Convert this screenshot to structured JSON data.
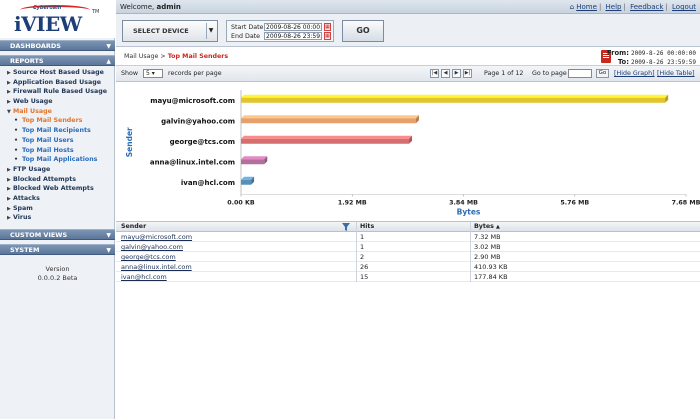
{
  "brand": {
    "company": "Cyberoam",
    "product": "iVIEW",
    "tm": "TM"
  },
  "header": {
    "welcome_prefix": "Welcome, ",
    "username": "admin",
    "links": [
      "Home",
      "Help",
      "Feedback",
      "Logout"
    ]
  },
  "sidebar": {
    "sections": {
      "dashboards": "DASHBOARDS",
      "reports": "REPORTS",
      "custom_views": "CUSTOM VIEWS",
      "system": "SYSTEM"
    },
    "report_items": [
      "Source Host Based Usage",
      "Application Based Usage",
      "Firewall Rule Based Usage",
      "Web Usage",
      "Mail Usage"
    ],
    "mail_sub_items": [
      "Top Mail Senders",
      "Top Mail Recipients",
      "Top Mail Users",
      "Top Mail Hosts",
      "Top Mail Applications"
    ],
    "report_items_after": [
      "FTP Usage",
      "Blocked Attempts",
      "Blocked Web Attempts",
      "Attacks",
      "Spam",
      "Virus"
    ],
    "version_label": "Version",
    "version_value": "0.0.0.2 Beta"
  },
  "controls": {
    "device_label": "SELECT DEVICE",
    "start_label": "Start Date",
    "start_value": "2009-08-26 00:00:",
    "end_label": "End Date",
    "end_value": "2009-08-26 23:59:",
    "go_label": "GO"
  },
  "breadcrumb": {
    "parent": "Mail Usage",
    "separator": " > ",
    "current": "Top Mail Senders"
  },
  "range": {
    "from_label": "From:",
    "from_value": "2009-8-26 00:00:00",
    "to_label": "To:",
    "to_value": "2009-8-26 23:59:59"
  },
  "toolbar": {
    "show_label": "Show",
    "rpp_value": "5",
    "rpp_suffix": "records per page",
    "page_info": "Page 1 of 12",
    "goto_label": "Go to page :",
    "go_small": "Go",
    "hide_graph": "[Hide Graph]",
    "hide_table": "[Hide Table]"
  },
  "chart_data": {
    "type": "bar",
    "orientation": "horizontal",
    "categories": [
      "mayu@microsoft.com",
      "galvin@yahoo.com",
      "george@tcs.com",
      "anna@linux.intel.com",
      "ivan@hcl.com"
    ],
    "values": [
      7.32,
      3.02,
      2.9,
      0.401,
      0.174
    ],
    "colors": [
      "#e3c42b",
      "#e8a06a",
      "#d56e6e",
      "#b4709c",
      "#5a8fb8"
    ],
    "xlim": [
      0,
      7.68
    ],
    "xticks": [
      "0.00 KB",
      "1.92 MB",
      "3.84 MB",
      "5.76 MB",
      "7.68 MB"
    ],
    "xlabel": "Bytes",
    "ylabel": "Sender"
  },
  "table": {
    "headers": {
      "sender": "Sender",
      "hits": "Hits",
      "bytes": "Bytes"
    },
    "rows": [
      {
        "sender": "mayu@microsoft.com",
        "hits": "1",
        "bytes": "7.32 MB"
      },
      {
        "sender": "galvin@yahoo.com",
        "hits": "1",
        "bytes": "3.02 MB"
      },
      {
        "sender": "george@tcs.com",
        "hits": "2",
        "bytes": "2.90 MB"
      },
      {
        "sender": "anna@linux.intel.com",
        "hits": "26",
        "bytes": "410.93 KB"
      },
      {
        "sender": "ivan@hcl.com",
        "hits": "15",
        "bytes": "177.84 KB"
      }
    ]
  }
}
